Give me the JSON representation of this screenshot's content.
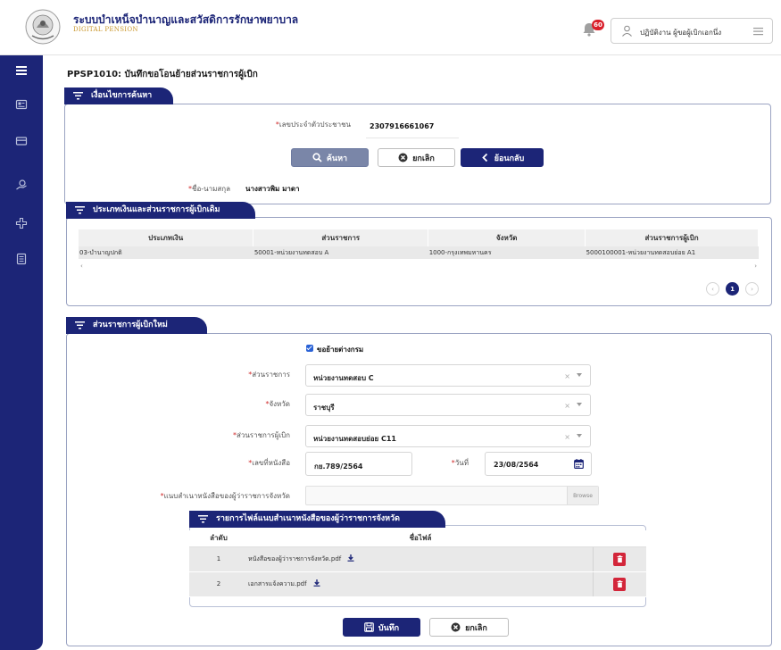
{
  "header": {
    "title": "ระบบบำเหน็จบำนาญและสวัสดิการรักษาพยาบาล",
    "subtitle": "DIGITAL PENSION",
    "notification_count": "60",
    "user_name": "ปฏิบัติงาน ผู้ขอผู้เบิกเอกนึ่ง"
  },
  "page": {
    "title": "PPSP1010: บันทึกขอโอนย้ายส่วนราชการผู้เบิก"
  },
  "search": {
    "tab_label": "เงื่อนไขการค้นหา",
    "id_label": "เลขประจำตัวประชาชน",
    "id_value": "2307916661067",
    "search_button": "ค้นหา",
    "cancel_button": "ยกเลิก",
    "back_button": "ย้อนกลับ",
    "name_label": "ชื่อ-นามสกุล",
    "name_value": "นางสาวพิม มาดา"
  },
  "old_agency": {
    "tab_label": "ประเภทเงินและส่วนราชการผู้เบิกเดิม",
    "columns": [
      "ประเภทเงิน",
      "ส่วนราชการ",
      "จังหวัด",
      "ส่วนราชการผู้เบิก"
    ],
    "rows": [
      [
        "03-บำนาญปกติ",
        "50001-หน่วยงานทดสอบ A",
        "1000-กรุงเทพมหานคร",
        "5000100001-หน่วยงานทดสอบย่อย A1"
      ]
    ],
    "scroll_left": "‹",
    "scroll_right": "›",
    "pager": {
      "prev": "‹",
      "current": "1",
      "next": "›"
    }
  },
  "new_agency": {
    "tab_label": "ส่วนราชการผู้เบิกใหม่",
    "checkbox_label": "ขอย้ายต่างกรม",
    "checkbox_checked": true,
    "agency_label": "ส่วนราชการ",
    "agency_value": "หน่วยงานทดสอบ C",
    "province_label": "จังหวัด",
    "province_value": "ราชบุรี",
    "sub_agency_label": "ส่วนราชการผู้เบิก",
    "sub_agency_value": "หน่วยงานทดสอบย่อย C11",
    "doc_no_label": "เลขที่หนังสือ",
    "doc_no_value": "กย.789/2564",
    "date_label": "วันที่",
    "date_value": "23/08/2564",
    "attach_label": "แนบสำเนาหนังสือของผู้ว่าราชการจังหวัด",
    "browse_label": "Browse",
    "clear_symbol": "×"
  },
  "files": {
    "tab_label": "รายการไฟล์แนบสำเนาหนังสือของผู้ว่าราชการจังหวัด",
    "col_no": "ลำดับ",
    "col_name": "ชื่อไฟล์",
    "rows": [
      {
        "no": "1",
        "name": "หนังสือของผู้ว่าราชการจังหวัด.pdf"
      },
      {
        "no": "2",
        "name": "เอกสารแจ้งความ.pdf"
      }
    ]
  },
  "actions": {
    "save_button": "บันทึก",
    "cancel_button": "ยกเลิก"
  },
  "colors": {
    "primary": "#1c2577",
    "danger": "#d3263a",
    "accent_gold": "#c9962a"
  }
}
